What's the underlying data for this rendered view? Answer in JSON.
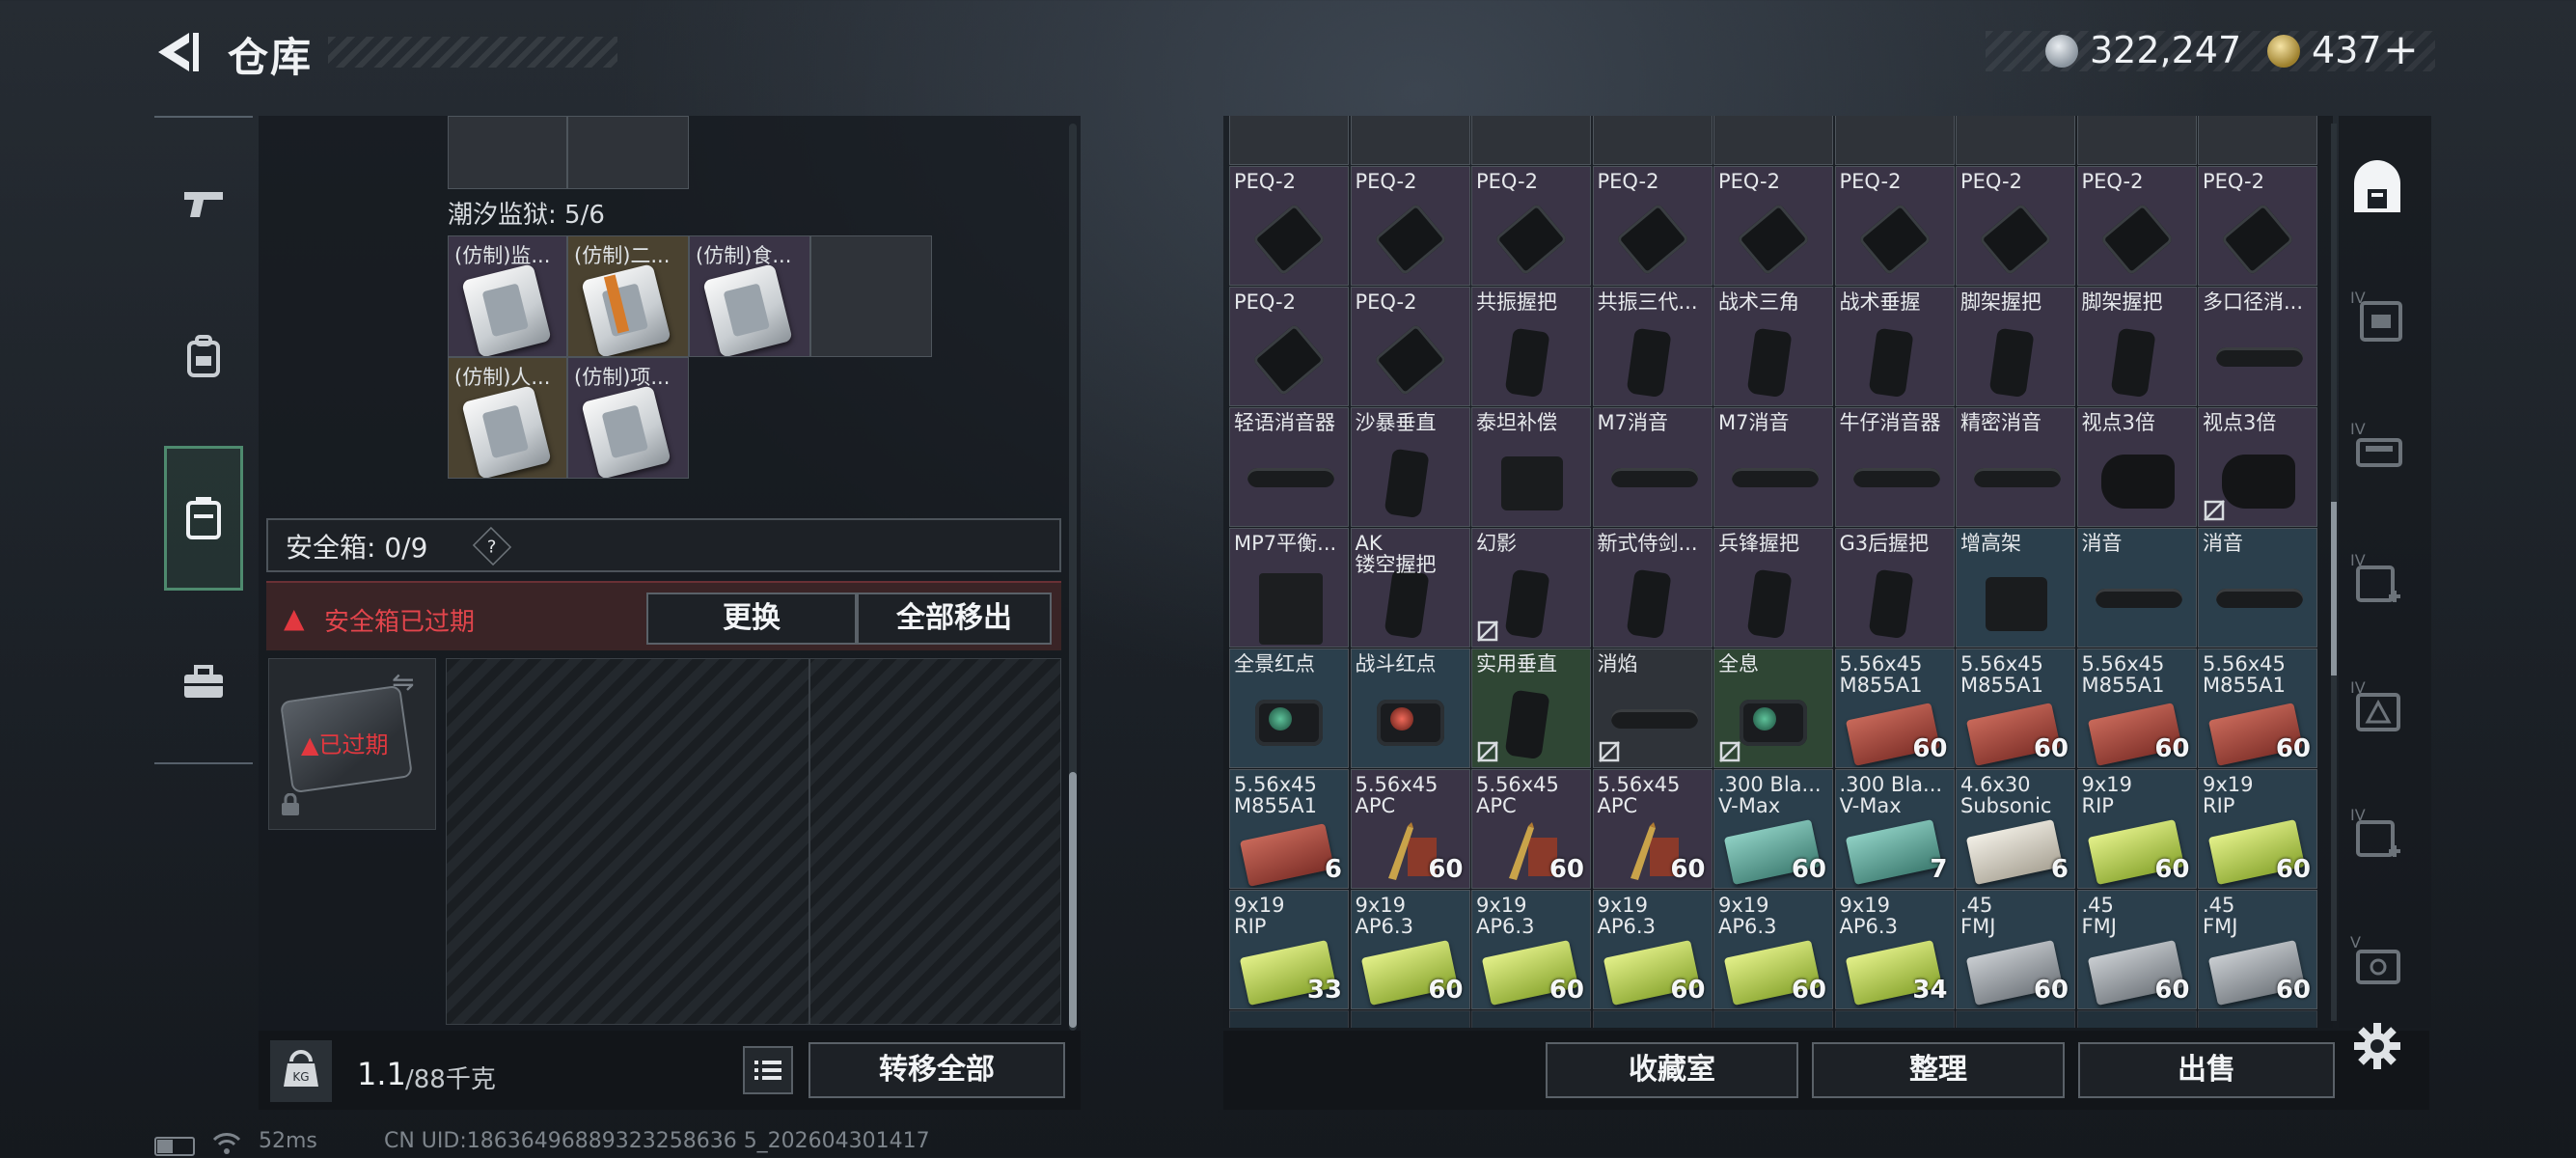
{
  "header": {
    "title": "仓库",
    "silver_amount": "322,247",
    "gold_amount": "437",
    "plus_label": "+"
  },
  "left_sidebar": {
    "tabs": [
      {
        "icon": "pistol-icon",
        "active": false
      },
      {
        "icon": "backpack-icon",
        "active": false
      },
      {
        "icon": "safe-case-icon",
        "active": true
      },
      {
        "icon": "toolbox-icon",
        "active": false
      }
    ]
  },
  "container": {
    "section_label": "潮汐监狱: 5/6",
    "cards": [
      {
        "name": "(仿制)监...",
        "rarity": "purple"
      },
      {
        "name": "(仿制)二...",
        "rarity": "gold"
      },
      {
        "name": "(仿制)食...",
        "rarity": "purple"
      },
      {
        "name": "(仿制)人...",
        "rarity": "gold"
      },
      {
        "name": "(仿制)项...",
        "rarity": "purple"
      }
    ]
  },
  "safebox": {
    "label": "安全箱: 0/9",
    "help": "?",
    "expired_warning": "安全箱已过期",
    "replace_button": "更换",
    "move_all_button": "全部移出",
    "case_status": "已过期"
  },
  "weight": {
    "current": "1.1",
    "limit": "/88千克"
  },
  "left_actions": {
    "transfer_all": "转移全部"
  },
  "stash": {
    "items": [
      {
        "n1": "PEQ-2",
        "n2": "",
        "bg": "purple",
        "icon": "peq",
        "count": "",
        "ban": false
      },
      {
        "n1": "PEQ-2",
        "n2": "",
        "bg": "purple",
        "icon": "peq",
        "count": "",
        "ban": false
      },
      {
        "n1": "PEQ-2",
        "n2": "",
        "bg": "purple",
        "icon": "peq",
        "count": "",
        "ban": false
      },
      {
        "n1": "PEQ-2",
        "n2": "",
        "bg": "purple",
        "icon": "peq",
        "count": "",
        "ban": false
      },
      {
        "n1": "PEQ-2",
        "n2": "",
        "bg": "purple",
        "icon": "peq",
        "count": "",
        "ban": false
      },
      {
        "n1": "PEQ-2",
        "n2": "",
        "bg": "purple",
        "icon": "peq",
        "count": "",
        "ban": false
      },
      {
        "n1": "PEQ-2",
        "n2": "",
        "bg": "purple",
        "icon": "peq",
        "count": "",
        "ban": false
      },
      {
        "n1": "PEQ-2",
        "n2": "",
        "bg": "purple",
        "icon": "peq",
        "count": "",
        "ban": false
      },
      {
        "n1": "PEQ-2",
        "n2": "",
        "bg": "purple",
        "icon": "peq",
        "count": "",
        "ban": false
      },
      {
        "n1": "PEQ-2",
        "n2": "",
        "bg": "purple",
        "icon": "peq",
        "count": "",
        "ban": false
      },
      {
        "n1": "PEQ-2",
        "n2": "",
        "bg": "purple",
        "icon": "peq",
        "count": "",
        "ban": false
      },
      {
        "n1": "共振握把",
        "n2": "",
        "bg": "purple",
        "icon": "grip",
        "count": "",
        "ban": false
      },
      {
        "n1": "共振三代...",
        "n2": "",
        "bg": "purple",
        "icon": "grip",
        "count": "",
        "ban": false
      },
      {
        "n1": "战术三角",
        "n2": "",
        "bg": "purple",
        "icon": "grip",
        "count": "",
        "ban": false
      },
      {
        "n1": "战术垂握",
        "n2": "",
        "bg": "purple",
        "icon": "grip",
        "count": "",
        "ban": false
      },
      {
        "n1": "脚架握把",
        "n2": "",
        "bg": "purple",
        "icon": "grip",
        "count": "",
        "ban": false
      },
      {
        "n1": "脚架握把",
        "n2": "",
        "bg": "purple",
        "icon": "grip",
        "count": "",
        "ban": false
      },
      {
        "n1": "多口径消...",
        "n2": "",
        "bg": "purple",
        "icon": "supp",
        "count": "",
        "ban": false
      },
      {
        "n1": "轻语消音器",
        "n2": "",
        "bg": "purple",
        "icon": "supp",
        "count": "",
        "ban": false
      },
      {
        "n1": "沙暴垂直",
        "n2": "",
        "bg": "purple",
        "icon": "grip",
        "count": "",
        "ban": false
      },
      {
        "n1": "泰坦补偿",
        "n2": "",
        "bg": "purple",
        "icon": "mount",
        "count": "",
        "ban": false
      },
      {
        "n1": "M7消音",
        "n2": "",
        "bg": "purple",
        "icon": "supp",
        "count": "",
        "ban": false
      },
      {
        "n1": "M7消音",
        "n2": "",
        "bg": "purple",
        "icon": "supp",
        "count": "",
        "ban": false
      },
      {
        "n1": "牛仔消音器",
        "n2": "",
        "bg": "purple",
        "icon": "supp",
        "count": "",
        "ban": false
      },
      {
        "n1": "精密消音",
        "n2": "",
        "bg": "purple",
        "icon": "supp",
        "count": "",
        "ban": false
      },
      {
        "n1": "视点3倍",
        "n2": "",
        "bg": "purple",
        "icon": "scope",
        "count": "",
        "ban": false
      },
      {
        "n1": "视点3倍",
        "n2": "",
        "bg": "purple",
        "icon": "scope",
        "count": "",
        "ban": true
      },
      {
        "n1": "MP7平衡...",
        "n2": "",
        "bg": "purple",
        "icon": "mag",
        "count": "",
        "ban": false
      },
      {
        "n1": "AK",
        "n2": "镂空握把",
        "bg": "purple",
        "icon": "grip",
        "count": "",
        "ban": false
      },
      {
        "n1": "幻影",
        "n2": "",
        "bg": "purple",
        "icon": "grip",
        "count": "",
        "ban": true
      },
      {
        "n1": "新式侍剑...",
        "n2": "",
        "bg": "purple",
        "icon": "grip",
        "count": "",
        "ban": false
      },
      {
        "n1": "兵锋握把",
        "n2": "",
        "bg": "purple",
        "icon": "grip",
        "count": "",
        "ban": false
      },
      {
        "n1": "G3后握把",
        "n2": "",
        "bg": "purple",
        "icon": "grip",
        "count": "",
        "ban": false
      },
      {
        "n1": "增高架",
        "n2": "",
        "bg": "blue",
        "icon": "mount",
        "count": "",
        "ban": false
      },
      {
        "n1": "消音",
        "n2": "",
        "bg": "blue",
        "icon": "supp",
        "count": "",
        "ban": false
      },
      {
        "n1": "消音",
        "n2": "",
        "bg": "blue",
        "icon": "supp",
        "count": "",
        "ban": false
      },
      {
        "n1": "全景红点",
        "n2": "",
        "bg": "blue",
        "icon": "dot-green",
        "count": "",
        "ban": false
      },
      {
        "n1": "战斗红点",
        "n2": "",
        "bg": "blue",
        "icon": "dot-red",
        "count": "",
        "ban": false
      },
      {
        "n1": "实用垂直",
        "n2": "",
        "bg": "green",
        "icon": "grip",
        "count": "",
        "ban": true
      },
      {
        "n1": "消焰",
        "n2": "",
        "bg": "gray",
        "icon": "supp",
        "count": "",
        "ban": true
      },
      {
        "n1": "全息",
        "n2": "",
        "bg": "green",
        "icon": "dot-green",
        "count": "",
        "ban": true
      },
      {
        "n1": "5.56x45",
        "n2": "M855A1",
        "bg": "blue",
        "icon": "ammo-red",
        "count": "60",
        "ban": false
      },
      {
        "n1": "5.56x45",
        "n2": "M855A1",
        "bg": "blue",
        "icon": "ammo-red",
        "count": "60",
        "ban": false
      },
      {
        "n1": "5.56x45",
        "n2": "M855A1",
        "bg": "blue",
        "icon": "ammo-red",
        "count": "60",
        "ban": false
      },
      {
        "n1": "5.56x45",
        "n2": "M855A1",
        "bg": "blue",
        "icon": "ammo-red",
        "count": "60",
        "ban": false
      },
      {
        "n1": "5.56x45",
        "n2": "M855A1",
        "bg": "blue",
        "icon": "ammo-red",
        "count": "6",
        "ban": false
      },
      {
        "n1": "5.56x45",
        "n2": "APC",
        "bg": "purple",
        "icon": "bullets",
        "count": "60",
        "ban": false
      },
      {
        "n1": "5.56x45",
        "n2": "APC",
        "bg": "purple",
        "icon": "bullets",
        "count": "60",
        "ban": false
      },
      {
        "n1": "5.56x45",
        "n2": "APC",
        "bg": "purple",
        "icon": "bullets",
        "count": "60",
        "ban": false
      },
      {
        "n1": ".300 Bla...",
        "n2": "V-Max",
        "bg": "blue",
        "icon": "ammo-teal",
        "count": "60",
        "ban": false
      },
      {
        "n1": ".300 Bla...",
        "n2": "V-Max",
        "bg": "blue",
        "icon": "ammo-teal",
        "count": "7",
        "ban": false
      },
      {
        "n1": "4.6x30",
        "n2": "Subsonic",
        "bg": "blue",
        "icon": "ammo-white",
        "count": "6",
        "ban": false
      },
      {
        "n1": "9x19",
        "n2": "RIP",
        "bg": "blue",
        "icon": "ammo-lime",
        "count": "60",
        "ban": false
      },
      {
        "n1": "9x19",
        "n2": "RIP",
        "bg": "blue",
        "icon": "ammo-lime",
        "count": "60",
        "ban": false
      },
      {
        "n1": "9x19",
        "n2": "RIP",
        "bg": "blue",
        "icon": "ammo-lime",
        "count": "33",
        "ban": false
      },
      {
        "n1": "9x19",
        "n2": "AP6.3",
        "bg": "blue",
        "icon": "ammo-lime",
        "count": "60",
        "ban": false
      },
      {
        "n1": "9x19",
        "n2": "AP6.3",
        "bg": "blue",
        "icon": "ammo-lime",
        "count": "60",
        "ban": false
      },
      {
        "n1": "9x19",
        "n2": "AP6.3",
        "bg": "blue",
        "icon": "ammo-lime",
        "count": "60",
        "ban": false
      },
      {
        "n1": "9x19",
        "n2": "AP6.3",
        "bg": "blue",
        "icon": "ammo-lime",
        "count": "60",
        "ban": false
      },
      {
        "n1": "9x19",
        "n2": "AP6.3",
        "bg": "blue",
        "icon": "ammo-lime",
        "count": "34",
        "ban": false
      },
      {
        "n1": ".45",
        "n2": "FMJ",
        "bg": "blue",
        "icon": "ammo-gray",
        "count": "60",
        "ban": false
      },
      {
        "n1": ".45",
        "n2": "FMJ",
        "bg": "blue",
        "icon": "ammo-gray",
        "count": "60",
        "ban": false
      },
      {
        "n1": ".45",
        "n2": "FMJ",
        "bg": "blue",
        "icon": "ammo-gray",
        "count": "60",
        "ban": false
      }
    ]
  },
  "right_actions": {
    "collection": "收藏室",
    "organize": "整理",
    "sell": "出售"
  },
  "right_sidebar": {
    "icons": [
      "stash-home-icon",
      "lvl4-backpack-icon",
      "lvl4-rig-icon",
      "lvl4-medkit-icon",
      "lvl4-warning-icon",
      "lvl4-add-icon",
      "lvl5-case-icon"
    ],
    "tier_labels": [
      "IV",
      "IV",
      "IV",
      "IV",
      "IV",
      "V"
    ]
  },
  "status": {
    "ping": "52ms",
    "uid": "CN UID:18636496889323258636 5_202604301417"
  },
  "colors": {
    "accent_green": "#4e8a6e",
    "warning_red": "#e2383f",
    "rarity_purple": "#3a3446",
    "rarity_blue": "#2b3f4c",
    "rarity_green": "#2f4634",
    "rarity_gold": "#4a4230"
  }
}
